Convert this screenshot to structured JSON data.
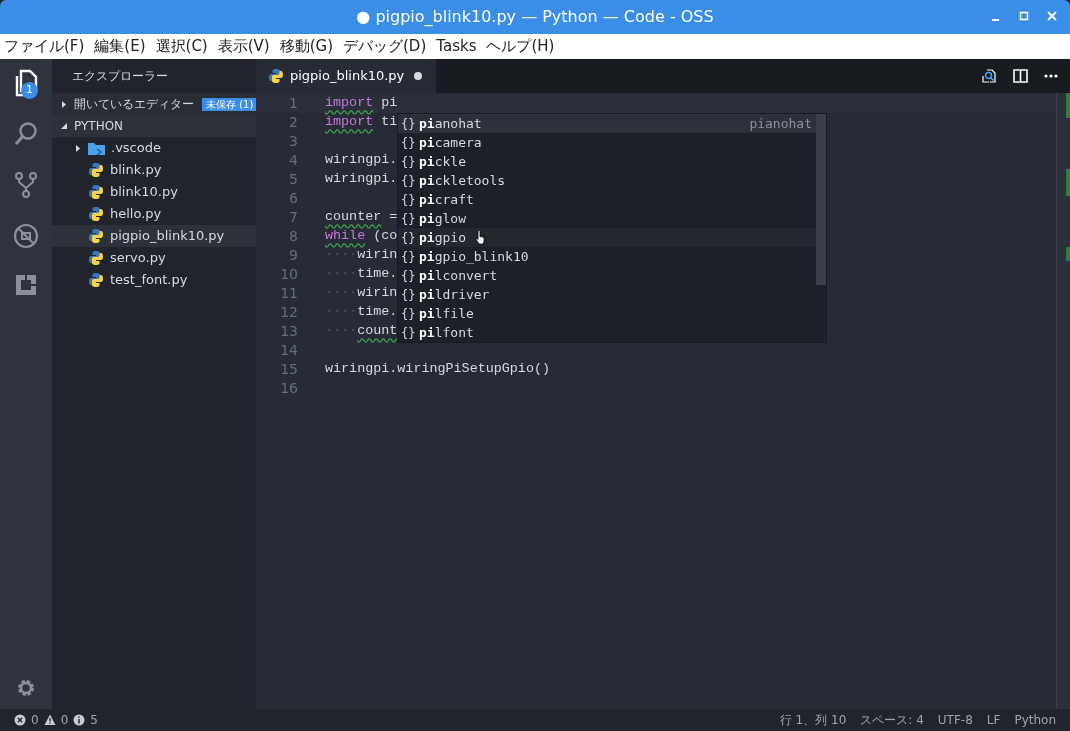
{
  "window": {
    "title": "● pigpio_blink10.py — Python — Code - OSS"
  },
  "menu": [
    "ファイル(F)",
    "編集(E)",
    "選択(C)",
    "表示(V)",
    "移動(G)",
    "デバッグ(D)",
    "Tasks",
    "ヘルプ(H)"
  ],
  "activity_bar": {
    "explorer_badge": "1"
  },
  "sidebar": {
    "title": "エクスプローラー",
    "sections": [
      {
        "label": "開いているエディター",
        "expanded": false,
        "badge": "未保存 (1)"
      },
      {
        "label": "PYTHON",
        "expanded": true,
        "children": [
          {
            "label": ".vscode",
            "kind": "folder",
            "expanded": false,
            "selected": false
          },
          {
            "label": "blink.py",
            "kind": "python",
            "selected": false
          },
          {
            "label": "blink10.py",
            "kind": "python",
            "selected": false
          },
          {
            "label": "hello.py",
            "kind": "python",
            "selected": false
          },
          {
            "label": "pigpio_blink10.py",
            "kind": "python",
            "selected": true
          },
          {
            "label": "servo.py",
            "kind": "python",
            "selected": false
          },
          {
            "label": "test_font.py",
            "kind": "python",
            "selected": false
          }
        ]
      }
    ]
  },
  "tabs": [
    {
      "label": "pigpio_blink10.py",
      "selected": true,
      "dirty": true
    }
  ],
  "editor": {
    "lines": [
      {
        "number": "1",
        "current": true,
        "tokens": [
          {
            "text": "import",
            "kind": "keyword",
            "squiggle": true
          },
          {
            "text": " pi",
            "kind": "plain"
          }
        ]
      },
      {
        "number": "2",
        "tokens": [
          {
            "text": "import",
            "kind": "keyword",
            "squiggle": true
          },
          {
            "text": " ti",
            "kind": "plain"
          }
        ]
      },
      {
        "number": "3"
      },
      {
        "number": "4",
        "tokens": [
          {
            "text": "wiringpi.",
            "kind": "plain"
          }
        ]
      },
      {
        "number": "5",
        "tokens": [
          {
            "text": "wiringpi.",
            "kind": "plain"
          }
        ]
      },
      {
        "number": "6"
      },
      {
        "number": "7",
        "tokens": [
          {
            "text": "counter",
            "kind": "plain",
            "squiggle": true
          },
          {
            "text": " =",
            "kind": "plain"
          }
        ]
      },
      {
        "number": "8",
        "tokens": [
          {
            "text": "while",
            "kind": "keyword",
            "squiggle": true
          },
          {
            "text": " (co",
            "kind": "plain"
          }
        ]
      },
      {
        "number": "9",
        "tokens": [
          {
            "text": "····",
            "kind": "whitespace"
          },
          {
            "text": "wirin",
            "kind": "plain"
          }
        ]
      },
      {
        "number": "10",
        "tokens": [
          {
            "text": "····",
            "kind": "whitespace"
          },
          {
            "text": "time.",
            "kind": "plain"
          }
        ]
      },
      {
        "number": "11",
        "tokens": [
          {
            "text": "····",
            "kind": "whitespace"
          },
          {
            "text": "wirin",
            "kind": "plain"
          }
        ]
      },
      {
        "number": "12",
        "tokens": [
          {
            "text": "····",
            "kind": "whitespace"
          },
          {
            "text": "time.",
            "kind": "plain"
          }
        ]
      },
      {
        "number": "13",
        "tokens": [
          {
            "text": "····",
            "kind": "whitespace"
          },
          {
            "text": "count",
            "kind": "plain",
            "squiggle": true
          }
        ]
      },
      {
        "number": "14"
      },
      {
        "number": "15",
        "tokens": [
          {
            "text": "wiringpi.wiringPiSetupGpio()",
            "kind": "plain"
          }
        ]
      },
      {
        "number": "16"
      }
    ]
  },
  "suggestions": [
    {
      "icon": "{}",
      "label": "**pi**anohat",
      "selected": true,
      "hovered": false,
      "detail": "pianohat"
    },
    {
      "icon": "{}",
      "label": "**pi**camera",
      "selected": false,
      "hovered": false
    },
    {
      "icon": "{}",
      "label": "**pi**ckle",
      "selected": false,
      "hovered": false
    },
    {
      "icon": "{}",
      "label": "**pi**ckletools",
      "selected": false,
      "hovered": false
    },
    {
      "icon": "{}",
      "label": "**pi**craft",
      "selected": false,
      "hovered": false
    },
    {
      "icon": "{}",
      "label": "**pi**glow",
      "selected": false,
      "hovered": false
    },
    {
      "icon": "{}",
      "label": "**pi**gpio",
      "selected": false,
      "hovered": true
    },
    {
      "icon": "{}",
      "label": "**pi**gpio_blink10",
      "selected": false,
      "hovered": false
    },
    {
      "icon": "{}",
      "label": "**pi**lconvert",
      "selected": false,
      "hovered": false
    },
    {
      "icon": "{}",
      "label": "**pi**ldriver",
      "selected": false,
      "hovered": false
    },
    {
      "icon": "{}",
      "label": "**pi**lfile",
      "selected": false,
      "hovered": false
    },
    {
      "icon": "{}",
      "label": "**pi**lfont",
      "selected": false,
      "hovered": false
    }
  ],
  "status_bar": {
    "errors": "0",
    "warnings": "0",
    "infos": "5",
    "items": [
      "行 1、列 10",
      "スペース: 4",
      "UTF-8",
      "LF",
      "Python"
    ]
  }
}
